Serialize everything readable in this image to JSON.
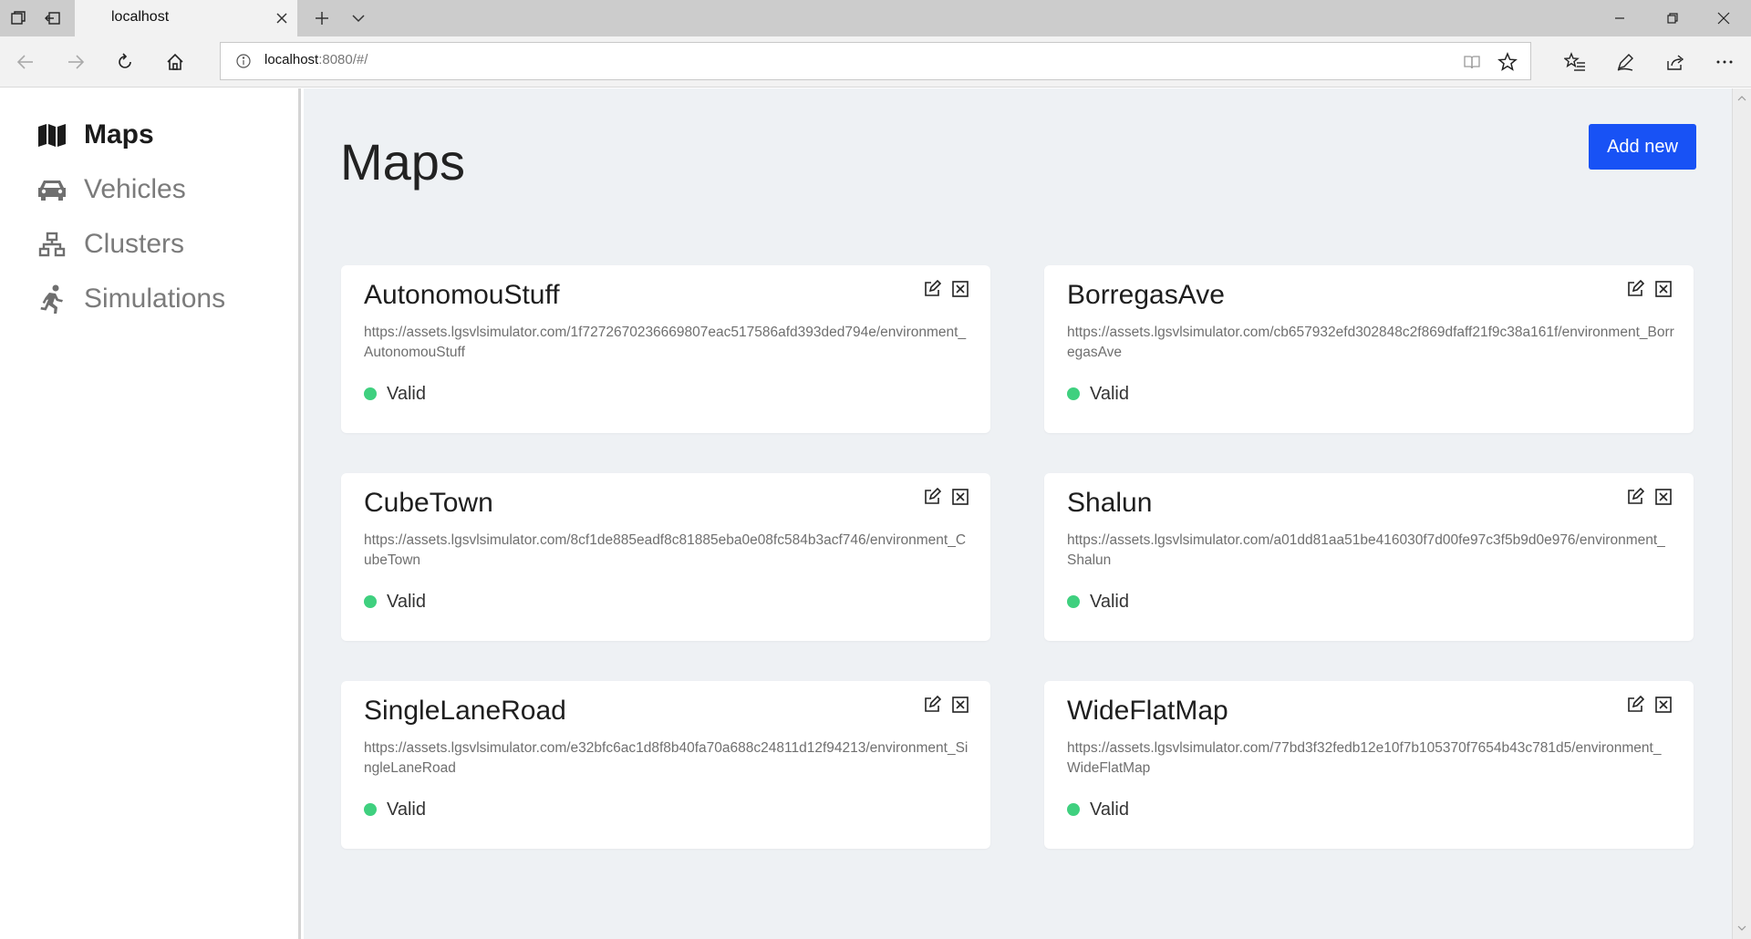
{
  "browser": {
    "tab_title": "localhost",
    "url_host": "localhost",
    "url_rest": ":8080/#/"
  },
  "sidebar": {
    "items": [
      {
        "label": "Maps",
        "icon": "map-icon",
        "active": true
      },
      {
        "label": "Vehicles",
        "icon": "car-icon",
        "active": false
      },
      {
        "label": "Clusters",
        "icon": "network-icon",
        "active": false
      },
      {
        "label": "Simulations",
        "icon": "running-icon",
        "active": false
      }
    ]
  },
  "main": {
    "title": "Maps",
    "add_button_label": "Add new",
    "maps": [
      {
        "name": "AutonomouStuff",
        "url": "https://assets.lgsvlsimulator.com/1f7272670236669807eac517586afd393ded794e/environment_AutonomouStuff",
        "status": "Valid"
      },
      {
        "name": "BorregasAve",
        "url": "https://assets.lgsvlsimulator.com/cb657932efd302848c2f869dfaff21f9c38a161f/environment_BorregasAve",
        "status": "Valid"
      },
      {
        "name": "CubeTown",
        "url": "https://assets.lgsvlsimulator.com/8cf1de885eadf8c81885eba0e08fc584b3acf746/environment_CubeTown",
        "status": "Valid"
      },
      {
        "name": "Shalun",
        "url": "https://assets.lgsvlsimulator.com/a01dd81aa51be416030f7d00fe97c3f5b9d0e976/environment_Shalun",
        "status": "Valid"
      },
      {
        "name": "SingleLaneRoad",
        "url": "https://assets.lgsvlsimulator.com/e32bfc6ac1d8f8b40fa70a688c24811d12f94213/environment_SingleLaneRoad",
        "status": "Valid"
      },
      {
        "name": "WideFlatMap",
        "url": "https://assets.lgsvlsimulator.com/77bd3f32fedb12e10f7b105370f7654b43c781d5/environment_WideFlatMap",
        "status": "Valid"
      }
    ]
  },
  "colors": {
    "accent": "#1852f5",
    "valid": "#3fd07f",
    "page_bg": "#eef1f4"
  }
}
